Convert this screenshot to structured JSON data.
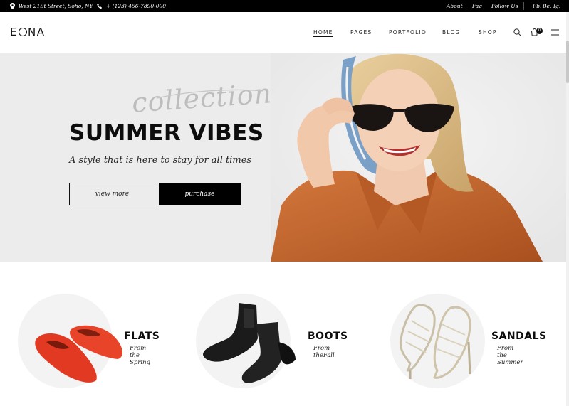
{
  "topbar": {
    "address": "West 21St Street, Soho, NY",
    "phone": "+ (123) 456-7890-000",
    "links": [
      "About",
      "Faq",
      "Follow Us"
    ],
    "social": [
      "Fb.",
      "Be.",
      "Ig."
    ]
  },
  "header": {
    "logo_left": "E",
    "logo_right": "NA",
    "nav": [
      "HOME",
      "PAGES",
      "PORTFOLIO",
      "BLOG",
      "SHOP"
    ],
    "cart_count": "0"
  },
  "hero": {
    "script_text": "collection",
    "title": "SUMMER VIBES",
    "subtitle": "A style that is here to stay for all times",
    "button_outline": "view more",
    "button_solid": "purchase"
  },
  "categories": [
    {
      "title": "FLATS",
      "subtitle": "From the Spring"
    },
    {
      "title": "BOOTS",
      "subtitle": "From theFall"
    },
    {
      "title": "SANDALS",
      "subtitle": "From the Summer"
    }
  ],
  "colors": {
    "topbar_bg": "#000000",
    "hero_bg": "#ececec",
    "accent_orange": "#c8652a",
    "flats_red": "#e23a22"
  }
}
